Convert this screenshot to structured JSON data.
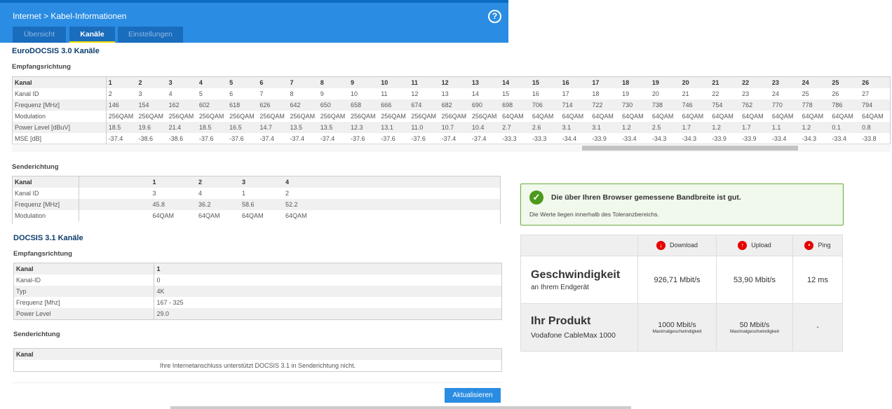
{
  "header": {
    "breadcrumb": "Internet > Kabel-Informationen",
    "help_icon": "?"
  },
  "tabs": [
    {
      "label": "Übersicht"
    },
    {
      "label": "Kanäle",
      "active": true
    },
    {
      "label": "Einstellungen"
    }
  ],
  "docsis30": {
    "title": "EuroDOCSIS 3.0 Kanäle",
    "downstream": {
      "title": "Empfangsrichtung",
      "row_labels": [
        "Kanal",
        "Kanal ID",
        "Frequenz [MHz]",
        "Modulation",
        "Power Level [dBuV]",
        "MSE [dB]"
      ],
      "kanal": [
        "1",
        "2",
        "3",
        "4",
        "5",
        "6",
        "7",
        "8",
        "9",
        "10",
        "11",
        "12",
        "13",
        "14",
        "15",
        "16",
        "17",
        "18",
        "19",
        "20",
        "21",
        "22",
        "23",
        "24",
        "25",
        "26"
      ],
      "kanal_id": [
        "2",
        "3",
        "4",
        "5",
        "6",
        "7",
        "8",
        "9",
        "10",
        "11",
        "12",
        "13",
        "14",
        "15",
        "16",
        "17",
        "18",
        "19",
        "20",
        "21",
        "22",
        "23",
        "24",
        "25",
        "26",
        "27"
      ],
      "frequenz": [
        "146",
        "154",
        "162",
        "602",
        "618",
        "626",
        "642",
        "650",
        "658",
        "666",
        "674",
        "682",
        "690",
        "698",
        "706",
        "714",
        "722",
        "730",
        "738",
        "746",
        "754",
        "762",
        "770",
        "778",
        "786",
        "794"
      ],
      "modulation": [
        "256QAM",
        "256QAM",
        "256QAM",
        "256QAM",
        "256QAM",
        "256QAM",
        "256QAM",
        "256QAM",
        "256QAM",
        "256QAM",
        "256QAM",
        "256QAM",
        "256QAM",
        "64QAM",
        "64QAM",
        "64QAM",
        "64QAM",
        "64QAM",
        "64QAM",
        "64QAM",
        "64QAM",
        "64QAM",
        "64QAM",
        "64QAM",
        "64QAM",
        "64QAM"
      ],
      "power": [
        "18.5",
        "19.6",
        "21.4",
        "18.5",
        "16.5",
        "14.7",
        "13.5",
        "13.5",
        "12.3",
        "13.1",
        "11.0",
        "10.7",
        "10.4",
        "2.7",
        "2.6",
        "3.1",
        "3.1",
        "1.2",
        "2.5",
        "1.7",
        "1.2",
        "1.7",
        "1.1",
        "1.2",
        "0.1",
        "0.8"
      ],
      "mse": [
        "-37.4",
        "-38.6",
        "-38.6",
        "-37.6",
        "-37.6",
        "-37.4",
        "-37.4",
        "-37.4",
        "-37.6",
        "-37.6",
        "-37.6",
        "-37.4",
        "-37.4",
        "-33.3",
        "-33.3",
        "-34.4",
        "-33.9",
        "-33.4",
        "-34.3",
        "-34.3",
        "-33.9",
        "-33.9",
        "-33.4",
        "-34.3",
        "-33.4",
        "-33.8"
      ]
    },
    "upstream": {
      "title": "Senderichtung",
      "row_labels": [
        "Kanal",
        "Kanal ID",
        "Frequenz [MHz]",
        "Modulation"
      ],
      "kanal": [
        "1",
        "2",
        "3",
        "4"
      ],
      "kanal_id": [
        "3",
        "4",
        "1",
        "2"
      ],
      "frequenz": [
        "45.8",
        "36.2",
        "58.6",
        "52.2"
      ],
      "modulation": [
        "64QAM",
        "64QAM",
        "64QAM",
        "64QAM"
      ]
    }
  },
  "docsis31": {
    "title": "DOCSIS 3.1 Kanäle",
    "downstream": {
      "title": "Empfangsrichtung",
      "rows": [
        [
          "Kanal",
          "1"
        ],
        [
          "Kanal-ID",
          "0"
        ],
        [
          "Typ",
          "4K"
        ],
        [
          "Frequenz [Mhz]",
          "167 - 325"
        ],
        [
          "Power Level",
          "29.0"
        ]
      ]
    },
    "upstream": {
      "title": "Senderichtung",
      "header": "Kanal",
      "message": "Ihre Internetanschluss unterstützt DOCSIS 3.1 in Senderichtung nicht."
    }
  },
  "refresh_button": "Aktualisieren",
  "speedtest": {
    "status_title": "Die über Ihren Browser gemessene Bandbreite ist gut.",
    "status_text": "Die Werte liegen innerhalb des Toleranzbereichs.",
    "columns": [
      "Download",
      "Upload",
      "Ping"
    ],
    "speed": {
      "title": "Geschwindigkeit",
      "subtitle": "an Ihrem Endgerät",
      "download": "926,71 Mbit/s",
      "upload": "53,90 Mbit/s",
      "ping": "12 ms"
    },
    "product": {
      "title": "Ihr Produkt",
      "subtitle": "Vodafone CableMax 1000",
      "download": "1000 Mbit/s",
      "upload": "50 Mbit/s",
      "max_label": "Maximalgeschwindigkeit",
      "ping": "-"
    },
    "colors": {
      "accent": "#e60000",
      "good": "#4c8c1a"
    }
  }
}
